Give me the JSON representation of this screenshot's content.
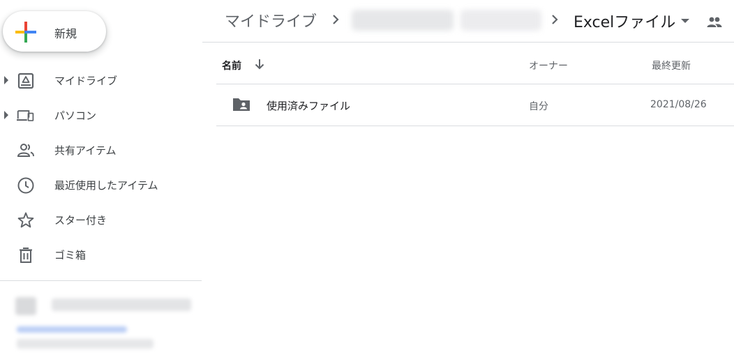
{
  "new_button": {
    "label": "新規"
  },
  "nav": {
    "items": [
      {
        "label": "マイドライブ",
        "icon": "my-drive-icon",
        "expandable": true
      },
      {
        "label": "パソコン",
        "icon": "computers-icon",
        "expandable": true
      },
      {
        "label": "共有アイテム",
        "icon": "shared-icon",
        "expandable": false
      },
      {
        "label": "最近使用したアイテム",
        "icon": "clock-icon",
        "expandable": false
      },
      {
        "label": "スター付き",
        "icon": "star-icon",
        "expandable": false
      },
      {
        "label": "ゴミ箱",
        "icon": "trash-icon",
        "expandable": false
      }
    ]
  },
  "breadcrumb": {
    "root": "マイドライブ",
    "current": "Excelファイル"
  },
  "list": {
    "headers": {
      "name": "名前",
      "owner": "オーナー",
      "modified": "最終更新"
    },
    "rows": [
      {
        "name": "使用済みファイル",
        "owner": "自分",
        "modified": "2021/08/26",
        "icon": "shared-folder-icon"
      }
    ]
  },
  "colors": {
    "icon_gray": "#5f6368",
    "text_dark": "#202124",
    "divider": "#dadce0",
    "google_blue": "#4285f4",
    "google_red": "#ea4335",
    "google_yellow": "#fbbc04",
    "google_green": "#34a853"
  }
}
